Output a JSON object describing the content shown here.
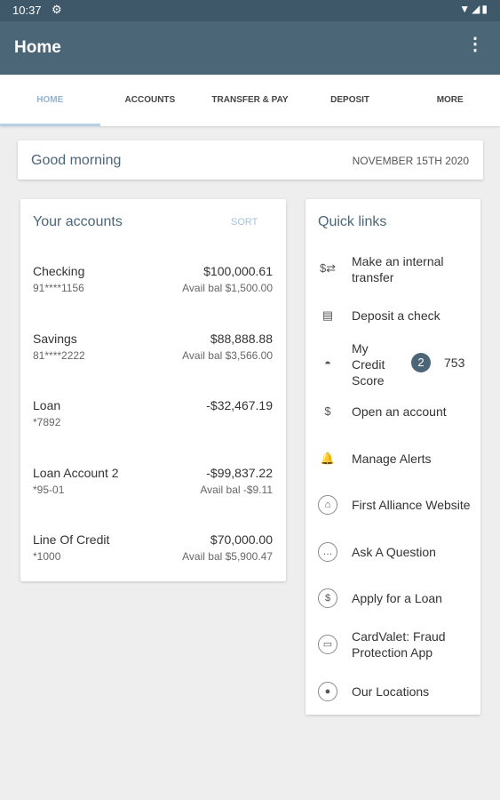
{
  "status_bar": {
    "time": "10:37"
  },
  "app_bar": {
    "title": "Home"
  },
  "tabs": [
    {
      "label": "HOME"
    },
    {
      "label": "ACCOUNTS"
    },
    {
      "label": "TRANSFER & PAY"
    },
    {
      "label": "DEPOSIT"
    },
    {
      "label": "MORE"
    }
  ],
  "greeting": {
    "text": "Good morning",
    "date": "NOVEMBER 15TH 2020"
  },
  "accounts": {
    "title": "Your accounts",
    "sort_label": "SORT",
    "items": [
      {
        "name": "Checking",
        "number": "91****1156",
        "balance": "$100,000.61",
        "available": "Avail bal $1,500.00"
      },
      {
        "name": "Savings",
        "number": "81****2222",
        "balance": "$88,888.88",
        "available": "Avail bal $3,566.00"
      },
      {
        "name": "Loan",
        "number": "*7892",
        "balance": "-$32,467.19",
        "available": ""
      },
      {
        "name": "Loan Account 2",
        "number": "*95-01",
        "balance": "-$99,837.22",
        "available": "Avail bal -$9.11"
      },
      {
        "name": "Line Of Credit",
        "number": "*1000",
        "balance": "$70,000.00",
        "available": "Avail bal $5,900.47"
      }
    ]
  },
  "quick_links": {
    "title": "Quick links",
    "items": [
      {
        "label": "Make an internal\ntransfer",
        "icon": "transfer-icon"
      },
      {
        "label": "Deposit a check",
        "icon": "check-icon"
      },
      {
        "label": "My\nCredit\nScore",
        "icon": "gauge-icon",
        "badge": "2",
        "value": "753"
      },
      {
        "label": "Open an account",
        "icon": "dollar-plus-icon"
      },
      {
        "label": "Manage Alerts",
        "icon": "bell-icon"
      },
      {
        "label": "First Alliance Website",
        "icon": "bank-icon"
      },
      {
        "label": "Ask A Question",
        "icon": "chat-icon"
      },
      {
        "label": "Apply for a Loan",
        "icon": "dollar-circle-icon"
      },
      {
        "label": "CardValet: Fraud\nProtection App",
        "icon": "card-icon"
      },
      {
        "label": "Our Locations",
        "icon": "location-icon"
      }
    ]
  },
  "colors": {
    "app_bar": "#4b6677",
    "status_bar": "#3f5869",
    "active_tab": "#8fb4d6"
  }
}
